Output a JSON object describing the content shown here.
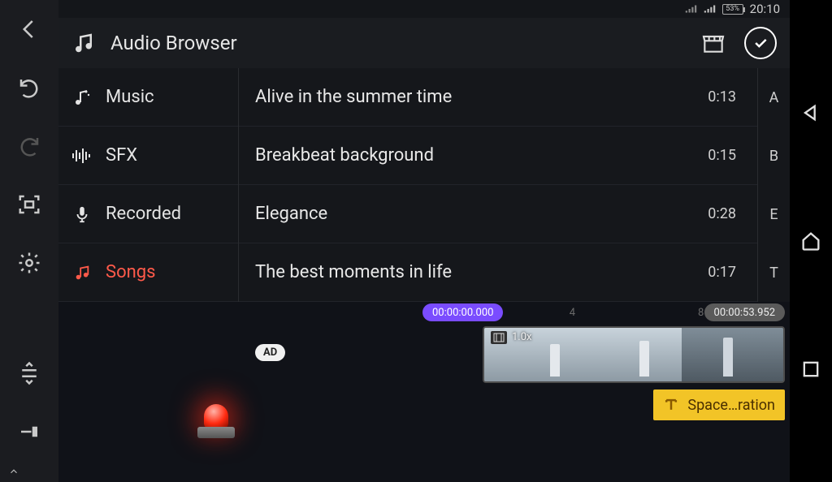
{
  "status": {
    "battery_pct": "53%",
    "clock": "20:10"
  },
  "header": {
    "title": "Audio Browser"
  },
  "categories": [
    {
      "icon": "music-note-spark",
      "label": "Music",
      "active": false
    },
    {
      "icon": "waveform",
      "label": "SFX",
      "active": false
    },
    {
      "icon": "mic",
      "label": "Recorded",
      "active": false
    },
    {
      "icon": "music-note",
      "label": "Songs",
      "active": true
    }
  ],
  "tracks": [
    {
      "title": "Alive in the summer time",
      "duration": "0:13"
    },
    {
      "title": "Breakbeat background",
      "duration": "0:15"
    },
    {
      "title": "Elegance",
      "duration": "0:28"
    },
    {
      "title": "The best moments in life",
      "duration": "0:17"
    }
  ],
  "alpha_index": [
    "A",
    "B",
    "E",
    "T"
  ],
  "ad": {
    "badge": "AD"
  },
  "timeline": {
    "playhead_time": "00:00:00.000",
    "end_time": "00:00:53.952",
    "ruler_marks": [
      {
        "label": "4",
        "left_pct": 40
      },
      {
        "label": "8",
        "left_pct": 75
      }
    ],
    "video_clip": {
      "speed": "1.0x"
    },
    "text_clip": {
      "label": "Space…ration"
    }
  }
}
